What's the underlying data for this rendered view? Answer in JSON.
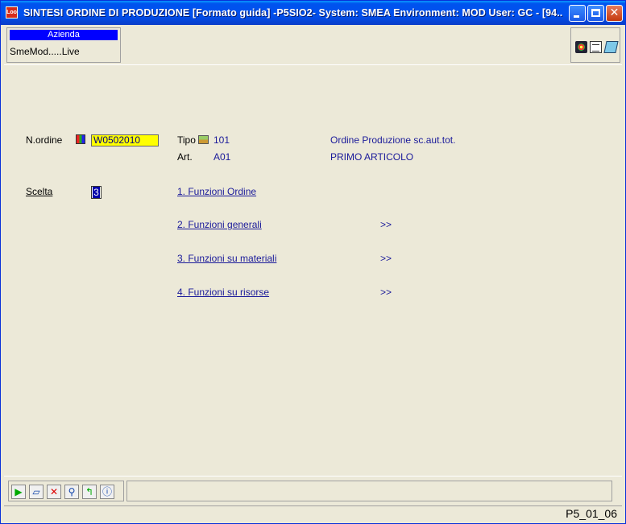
{
  "window": {
    "title": "SINTESI ORDINE DI PRODUZIONE [Formato guida] -P5SIO2- System: SMEA Environment: MOD User: GC - [94...",
    "app_icon": "app-icon",
    "app_icon_text": "Loo"
  },
  "header": {
    "azienda_label": "Azienda",
    "azienda_value": "SmeMod.....Live"
  },
  "form": {
    "order_label": "N.ordine",
    "order_value": "W0502010",
    "tipo_label": "Tipo",
    "tipo_value": "101",
    "tipo_desc": "Ordine Produzione sc.aut.tot.",
    "art_label": "Art.",
    "art_value": "A01",
    "art_desc": "PRIMO ARTICOLO",
    "scelta_label": "Scelta",
    "scelta_value": "3"
  },
  "menu": [
    {
      "label": "1. Funzioni Ordine",
      "more": ""
    },
    {
      "label": "2. Funzioni generali",
      "more": ">>"
    },
    {
      "label": "3. Funzioni su materiali",
      "more": ">>"
    },
    {
      "label": "4. Funzioni su risorse",
      "more": ">>"
    }
  ],
  "toolbar": {
    "icons": [
      "run-icon",
      "eraser-icon",
      "delete-icon",
      "search-icon",
      "back-icon",
      "info-icon"
    ]
  },
  "status": {
    "code": "P5_01_06"
  },
  "colors": {
    "titlebar": "#0053ee",
    "input_highlight": "#ffff00",
    "link": "#1a1a9a",
    "azienda_header": "#0000ff"
  }
}
